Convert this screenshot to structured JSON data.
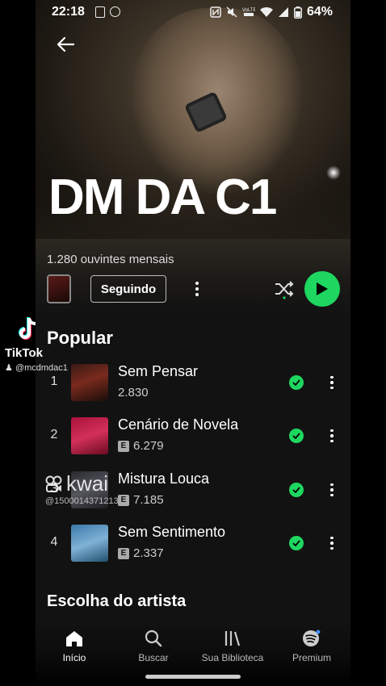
{
  "status_bar": {
    "time": "22:18",
    "battery": "64%"
  },
  "artist": {
    "name": "DM DA C1",
    "monthly_listeners": "1.280 ouvintes mensais",
    "follow_label": "Seguindo"
  },
  "popular": {
    "title": "Popular",
    "tracks": [
      {
        "rank": "1",
        "title": "Sem Pensar",
        "plays": "2.830",
        "explicit": false,
        "explicit_label": "",
        "saved": true
      },
      {
        "rank": "2",
        "title": "Cenário de Novela",
        "plays": "6.279",
        "explicit": true,
        "explicit_label": "E",
        "saved": true
      },
      {
        "rank": "3",
        "title": "Mistura Louca",
        "plays": "7.185",
        "explicit": true,
        "explicit_label": "E",
        "saved": true
      },
      {
        "rank": "4",
        "title": "Sem Sentimento",
        "plays": "2.337",
        "explicit": true,
        "explicit_label": "E",
        "saved": true
      }
    ]
  },
  "artist_pick": {
    "title": "Escolha do artista"
  },
  "nav": {
    "items": [
      {
        "label": "Início",
        "icon": "home-icon",
        "active": true
      },
      {
        "label": "Buscar",
        "icon": "search-icon",
        "active": false
      },
      {
        "label": "Sua Biblioteca",
        "icon": "library-icon",
        "active": false
      },
      {
        "label": "Premium",
        "icon": "spotify-icon",
        "active": false
      }
    ]
  },
  "overlays": {
    "tiktok": {
      "brand": "TikTok",
      "user": "@mcdmdac1"
    },
    "kwai": {
      "brand": "kwai",
      "user_id": "@1500014371213"
    }
  },
  "colors": {
    "accent": "#1ed760",
    "background": "#121212"
  }
}
